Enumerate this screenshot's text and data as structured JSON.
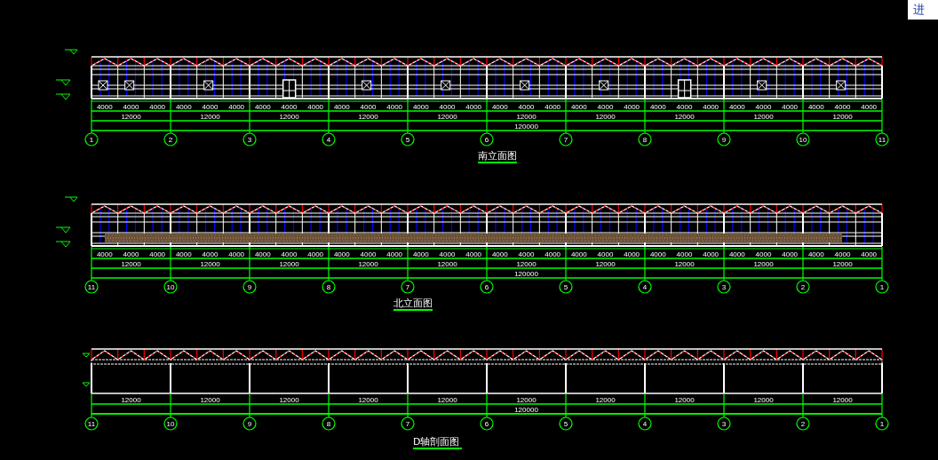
{
  "corner_button": {
    "label": "进"
  },
  "views": [
    {
      "kind": "fan-wall",
      "title": "南立面图",
      "axes": [
        "1",
        "2",
        "3",
        "4",
        "5",
        "6",
        "7",
        "8",
        "9",
        "10",
        "11"
      ],
      "segment_dims": [
        "4000",
        "4000",
        "4000",
        "4000",
        "4000",
        "4000",
        "4000",
        "4000",
        "4000",
        "4000",
        "4000",
        "4000",
        "4000",
        "4000",
        "4000",
        "4000",
        "4000",
        "4000",
        "4000",
        "4000",
        "4000",
        "4000",
        "4000",
        "4000",
        "4000",
        "4000",
        "4000",
        "4000",
        "4000",
        "4000"
      ],
      "bay_dims": [
        "12000",
        "12000",
        "12000",
        "12000",
        "12000",
        "12000",
        "12000",
        "12000",
        "12000",
        "12000"
      ],
      "overall": "120000"
    },
    {
      "kind": "curtain-wall",
      "title": "北立面图",
      "axes": [
        "11",
        "10",
        "9",
        "8",
        "7",
        "6",
        "5",
        "4",
        "3",
        "2",
        "1"
      ],
      "segment_dims": [
        "4000",
        "4000",
        "4000",
        "4000",
        "4000",
        "4000",
        "4000",
        "4000",
        "4000",
        "4000",
        "4000",
        "4000",
        "4000",
        "4000",
        "4000",
        "4000",
        "4000",
        "4000",
        "4000",
        "4000",
        "4000",
        "4000",
        "4000",
        "4000",
        "4000",
        "4000",
        "4000",
        "4000",
        "4000",
        "4000"
      ],
      "bay_dims": [
        "12000",
        "12000",
        "12000",
        "12000",
        "12000",
        "12000",
        "12000",
        "12000",
        "12000",
        "12000"
      ],
      "overall": "120000"
    },
    {
      "kind": "section",
      "title": "D轴剖面图",
      "axes": [
        "11",
        "10",
        "9",
        "8",
        "7",
        "6",
        "5",
        "4",
        "3",
        "2",
        "1"
      ],
      "bay_dims": [
        "12000",
        "12000",
        "12000",
        "12000",
        "12000",
        "12000",
        "12000",
        "12000",
        "12000",
        "12000"
      ],
      "overall": "120000"
    }
  ]
}
